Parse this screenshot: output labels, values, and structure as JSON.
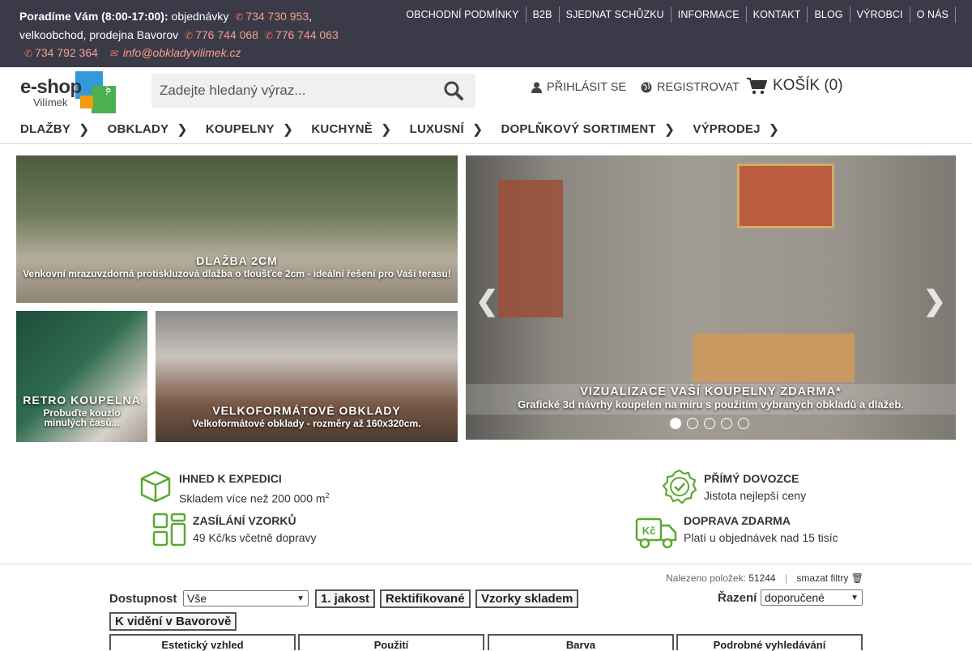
{
  "topbar": {
    "intro_bold": "Poradíme Vám (8:00-17:00):",
    "intro_text": " objednávky",
    "phone1": "734 730 953",
    "line2": "velkoobchod, prodejna Bavorov",
    "phone2": "776 744 068",
    "phone3": "776 744 063",
    "phone4": "734 792 364",
    "email": "info@obkladyvilimek.cz",
    "nav": [
      "OBCHODNÍ PODMÍNKY",
      "B2B",
      "SJEDNAT SCHŮZKU",
      "INFORMACE",
      "KONTAKT",
      "BLOG",
      "VÝROBCI",
      "O NÁS"
    ]
  },
  "header": {
    "logo_main": "e-shop",
    "logo_sub": "Vilímek",
    "logo_badge": "s.r.o.",
    "search_placeholder": "Zadejte hledaný výraz...",
    "login": "PŘIHLÁSIT SE",
    "register": "REGISTROVAT",
    "cart": "KOŠÍK (0)"
  },
  "mainnav": [
    "DLAŽBY",
    "OBKLADY",
    "KOUPELNY",
    "KUCHYNĚ",
    "LUXUSNÍ",
    "DOPLŇKOVÝ SORTIMENT",
    "VÝPRODEJ"
  ],
  "banners": {
    "b1_title": "DLAŽBA 2CM",
    "b1_sub": "Venkovní mrazuvzdorná protiskluzová dlažba o tloušťce 2cm - ideální řešení pro Vaši terasu!",
    "b2_title": "RETRO KOUPELNA",
    "b2_sub": "Probuďte kouzlo minulých časů...",
    "b3_title": "VELKOFORMÁTOVÉ OBKLADY",
    "b3_sub": "Velkoformátové obklady - rozměry až 160x320cm.",
    "b4_title": "VIZUALIZACE VAŠÍ KOUPELNY ZDARMA*",
    "b4_sub": "Grafické 3d návrhy koupelen na míru s použitím vybraných obkladů a dlažeb.",
    "slider_active": 1,
    "slider_count": 5
  },
  "features": {
    "f1_title": "IHNED K EXPEDICI",
    "f1_text": "Skladem více než 200 000 m",
    "f1_sup": "2",
    "f2_title": "PŘÍMÝ DOVOZCE",
    "f2_text": "Jistota nejlepší ceny",
    "f3_title": "ZASÍLÁNÍ VZORKŮ",
    "f3_text": "49 Kč/ks včetně dopravy",
    "f4_title": "DOPRAVA ZDARMA",
    "f4_text": "Platí u objednávek nad 15 tisíc",
    "f4_icon_text": "Kč"
  },
  "filters": {
    "found_label": "Nalezeno položek:",
    "found_count": "51244",
    "clear": "smazat filtry",
    "availability_label": "Dostupnost",
    "availability_value": "Vše",
    "btn1": "1. jakost",
    "btn2": "Rektifikované",
    "btn3": "Vzorky skladem",
    "btn4": "K vidění v Bavorově",
    "sort_label": "Řazení",
    "sort_value": "doporučené",
    "tabs": [
      "Estetický vzhled",
      "Použití",
      "Barva",
      "Podrobné vyhledávání"
    ]
  },
  "colors": {
    "topbar_bg": "#3a3a48",
    "accent_orange": "#e8755c",
    "feature_green": "#5aa832"
  }
}
